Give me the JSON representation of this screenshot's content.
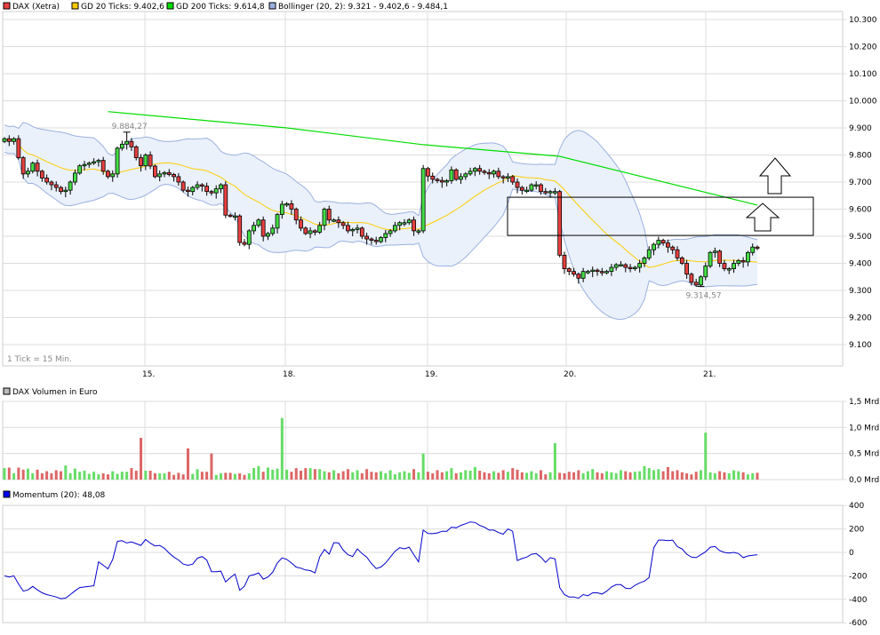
{
  "chart_data": {
    "type": "candlestick",
    "legend": [
      {
        "label": "DAX (Xetra)",
        "color": "#e84040"
      },
      {
        "label": "GD 20 Ticks: 9.402,6",
        "color": "#ffcc00"
      },
      {
        "label": "GD 200 Ticks: 9.614,8",
        "color": "#00dd00"
      },
      {
        "label": "Bollinger (20, 2): 9.321 - 9.402,6 - 9.484,1",
        "color": "#9bb0e0"
      }
    ],
    "tick_note": "1 Tick = 15 Min.",
    "x_ticks": [
      "15.",
      "18.",
      "19.",
      "20.",
      "21."
    ],
    "price_axis": {
      "ticks": [
        "10.300",
        "10.200",
        "10.100",
        "10.000",
        "9.900",
        "9.800",
        "9.700",
        "9.600",
        "9.500",
        "9.400",
        "9.300",
        "9.200",
        "9.100"
      ],
      "ylim": [
        9000,
        10300
      ]
    },
    "closes": [
      9860,
      9850,
      9860,
      9790,
      9730,
      9740,
      9770,
      9740,
      9715,
      9700,
      9690,
      9680,
      9665,
      9670,
      9700,
      9733,
      9760,
      9765,
      9770,
      9775,
      9780,
      9740,
      9720,
      9730,
      9825,
      9840,
      9850,
      9830,
      9790,
      9760,
      9800,
      9759,
      9720,
      9730,
      9735,
      9728,
      9720,
      9700,
      9670,
      9665,
      9680,
      9690,
      9685,
      9665,
      9660,
      9675,
      9690,
      9578,
      9575,
      9575,
      9477,
      9470,
      9520,
      9540,
      9560,
      9500,
      9510,
      9530,
      9580,
      9618,
      9620,
      9600,
      9560,
      9530,
      9510,
      9520,
      9515,
      9540,
      9600,
      9560,
      9560,
      9550,
      9540,
      9520,
      9525,
      9530,
      9500,
      9490,
      9485,
      9480,
      9495,
      9510,
      9520,
      9540,
      9550,
      9550,
      9560,
      9520,
      9520,
      9750,
      9722,
      9710,
      9706,
      9700,
      9705,
      9745,
      9710,
      9720,
      9730,
      9740,
      9750,
      9740,
      9735,
      9730,
      9740,
      9720,
      9715,
      9720,
      9700,
      9680,
      9670,
      9670,
      9690,
      9690,
      9665,
      9660,
      9665,
      9665,
      9430,
      9380,
      9370,
      9360,
      9345,
      9370,
      9370,
      9375,
      9370,
      9365,
      9370,
      9385,
      9395,
      9395,
      9385,
      9380,
      9385,
      9400,
      9420,
      9450,
      9470,
      9485,
      9475,
      9460,
      9450,
      9420,
      9400,
      9360,
      9330,
      9320,
      9350,
      9390,
      9440,
      9445,
      9400,
      9380,
      9380,
      9400,
      9410,
      9405,
      9440,
      9460,
      9455
    ],
    "first_open": 9850,
    "annotations": [
      {
        "label": "9.884,27",
        "index": 26,
        "price": 9884.27,
        "kind": "high"
      },
      {
        "label": "9.314,57",
        "index": 148,
        "price": 9314.57,
        "kind": "low"
      }
    ],
    "gd200": [
      [
        22,
        9960
      ],
      [
        60,
        9900
      ],
      [
        89,
        9838
      ],
      [
        118,
        9795
      ],
      [
        160,
        9615
      ]
    ],
    "resistance_zone": [
      9503,
      9644
    ],
    "volume": {
      "title": "DAX Volumen in Euro",
      "unit": "Mrd",
      "ticks": [
        "1,5 Mrd",
        "1,0 Mrd",
        "0,5 Mrd",
        "0,0 Mrd"
      ],
      "ylim": [
        0,
        1.5
      ],
      "values": [
        0.22,
        0.23,
        0.12,
        0.23,
        0.19,
        0.21,
        0.12,
        0.19,
        0.12,
        0.16,
        0.12,
        0.18,
        0.16,
        0.27,
        0.12,
        0.21,
        0.15,
        0.17,
        0.11,
        0.15,
        0.1,
        0.12,
        0.1,
        0.16,
        0.11,
        0.15,
        0.15,
        0.22,
        0.17,
        0.8,
        0.17,
        0.17,
        0.12,
        0.12,
        0.12,
        0.15,
        0.09,
        0.13,
        0.1,
        0.6,
        0.11,
        0.2,
        0.15,
        0.15,
        0.5,
        0.09,
        0.12,
        0.13,
        0.13,
        0.11,
        0.12,
        0.09,
        0.12,
        0.22,
        0.26,
        0.15,
        0.23,
        0.19,
        0.21,
        1.18,
        0.19,
        0.15,
        0.22,
        0.17,
        0.22,
        0.22,
        0.2,
        0.2,
        0.16,
        0.14,
        0.18,
        0.12,
        0.16,
        0.2,
        0.14,
        0.18,
        0.12,
        0.2,
        0.15,
        0.14,
        0.16,
        0.12,
        0.18,
        0.1,
        0.14,
        0.16,
        0.13,
        0.2,
        0.14,
        0.5,
        0.15,
        0.12,
        0.18,
        0.14,
        0.16,
        0.22,
        0.12,
        0.14,
        0.18,
        0.17,
        0.24,
        0.17,
        0.14,
        0.12,
        0.16,
        0.13,
        0.18,
        0.15,
        0.22,
        0.19,
        0.14,
        0.13,
        0.16,
        0.12,
        0.18,
        0.1,
        0.14,
        0.7,
        0.13,
        0.12,
        0.15,
        0.14,
        0.18,
        0.12,
        0.16,
        0.2,
        0.14,
        0.12,
        0.16,
        0.14,
        0.12,
        0.18,
        0.16,
        0.14,
        0.15,
        0.16,
        0.26,
        0.22,
        0.18,
        0.2,
        0.16,
        0.24,
        0.16,
        0.18,
        0.14,
        0.12,
        0.1,
        0.15,
        0.18,
        0.9,
        0.14,
        0.12,
        0.16,
        0.14,
        0.12,
        0.18,
        0.16,
        0.14,
        0.1,
        0.12,
        0.13
      ]
    },
    "momentum": {
      "title": "Momentum (20): 48,08",
      "period": 20,
      "ticks": [
        "400",
        "200",
        "0",
        "-200",
        "-400",
        "-600"
      ],
      "ylim": [
        -600,
        400
      ],
      "color": "#0000cc"
    },
    "colors": {
      "up": "#44dd44",
      "down": "#e84040",
      "vol_up": "#66dd66",
      "vol_down": "#dd6666",
      "sma": "#ffcc00",
      "band": "#9bb0e0",
      "band_fill": "#eaf1fb",
      "gd200": "#00dd00"
    }
  }
}
